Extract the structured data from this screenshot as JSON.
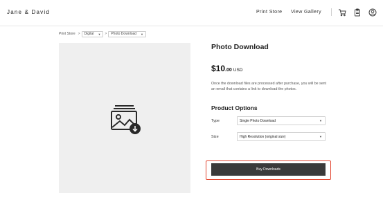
{
  "header": {
    "brand": "Jane & David",
    "nav": {
      "print_store": "Print Store",
      "view_gallery": "View Gallery"
    },
    "icons": [
      "cart-icon",
      "clipboard-icon",
      "account-icon"
    ]
  },
  "breadcrumb": {
    "root": "Print Store",
    "separator": ">",
    "category": "Digital",
    "product": "Photo Download"
  },
  "product": {
    "title": "Photo Download",
    "price_main": "$10",
    "price_cents": ".00",
    "currency": "USD",
    "description": "Once the download files are processed after purchase, you will be sent an email that contains a link to download the photos.",
    "image_icon": "photo-download-icon"
  },
  "options": {
    "heading": "Product Options",
    "type": {
      "label": "Type",
      "value": "Single Photo Download"
    },
    "size": {
      "label": "Size",
      "value": "High Resolution (original size)"
    }
  },
  "cta": {
    "label": "Buy Downloads"
  },
  "colors": {
    "highlight": "#e2452f",
    "button": "#3a3a3a",
    "image_bg": "#efefef"
  }
}
